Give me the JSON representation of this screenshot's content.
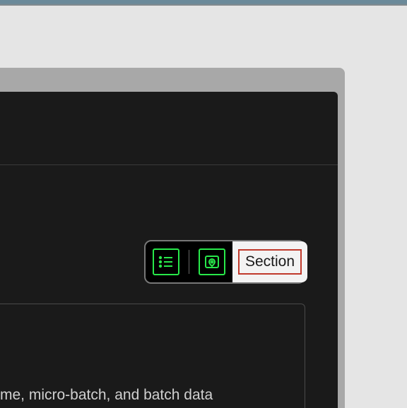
{
  "toolbar": {
    "list_icon": "list-icon",
    "map_icon": "map-pin-icon",
    "section_label": "Section"
  },
  "content": {
    "line1": "me, micro-batch, and batch data"
  }
}
